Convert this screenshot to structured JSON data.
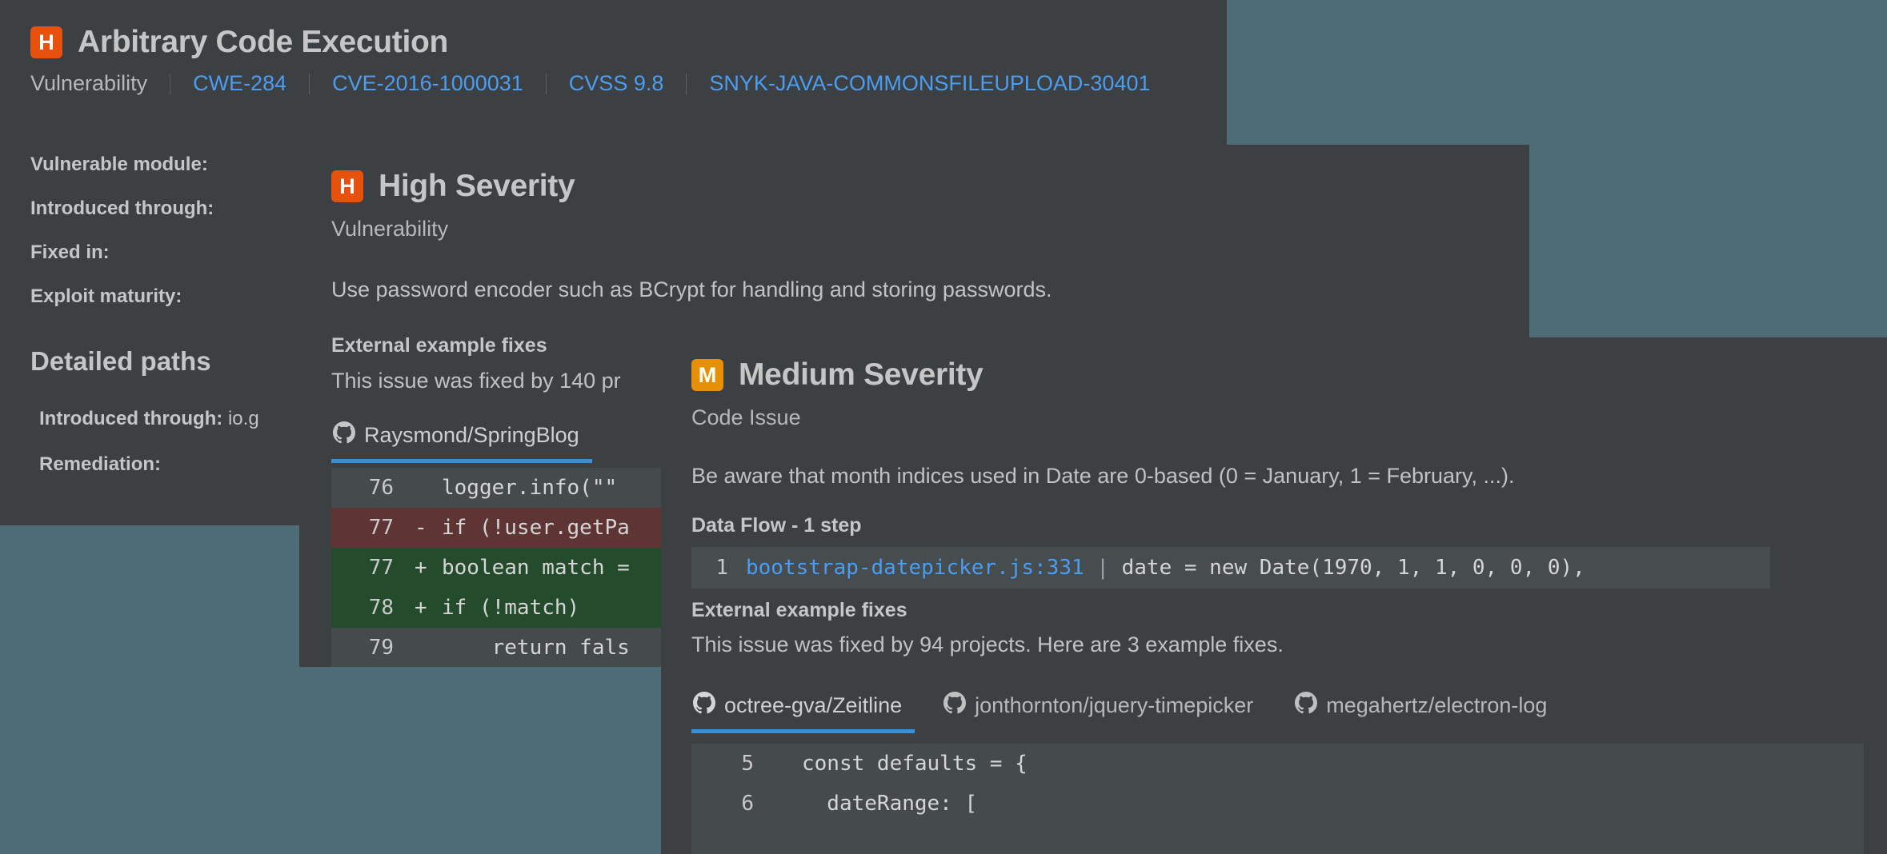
{
  "colors": {
    "desktop_background": "#4e6c76",
    "panel_background": "#3c4043",
    "high_severity": "#e6520e",
    "medium_severity": "#e69008",
    "link": "#4a9df0",
    "tab_active_underline": "#3b8fd4",
    "code_background": "#454a4d",
    "diff_removed": "#5e3434",
    "diff_added": "#234b2c"
  },
  "vulnerability_panel": {
    "badge_letter": "H",
    "badge_severity": "high",
    "title": "Arbitrary Code Execution",
    "meta": {
      "type": "Vulnerability",
      "links": [
        "CWE-284",
        "CVE-2016-1000031",
        "CVSS 9.8",
        "SNYK-JAVA-COMMONSFILEUPLOAD-30401"
      ]
    },
    "fields": [
      "Vulnerable module:",
      "Introduced through:",
      "Fixed in:",
      "Exploit maturity:"
    ],
    "detailed_paths_heading": "Detailed paths",
    "detailed_paths": [
      {
        "label": "Introduced through:",
        "value": "io.g"
      },
      {
        "label": "Remediation:",
        "value": ""
      }
    ]
  },
  "high_panel": {
    "badge_letter": "H",
    "badge_severity": "high",
    "title": "High Severity",
    "subtitle": "Vulnerability",
    "description": "Use password encoder such as BCrypt for handling and storing passwords.",
    "external_fixes_heading": "External example fixes",
    "external_fixes_summary": "This issue was fixed by 140 pr",
    "repo_tabs": [
      {
        "name": "Raysmond/SpringBlog",
        "active": true
      }
    ],
    "code_lines": [
      {
        "number": "76",
        "sign": "",
        "text": "logger.info(\"\" ",
        "kind": "context"
      },
      {
        "number": "77",
        "sign": "-",
        "text": "if (!user.getPa",
        "kind": "removed"
      },
      {
        "number": "77",
        "sign": "+",
        "text": "boolean match =",
        "kind": "added"
      },
      {
        "number": "78",
        "sign": "+",
        "text": "if (!match)",
        "kind": "added"
      },
      {
        "number": "79",
        "sign": "",
        "text": "    return fals",
        "kind": "context"
      }
    ]
  },
  "medium_panel": {
    "badge_letter": "M",
    "badge_severity": "medium",
    "title": "Medium Severity",
    "subtitle": "Code Issue",
    "description": "Be aware that month indices used in Date are 0-based (0 = January, 1 = February, ...).",
    "data_flow_heading": "Data Flow - 1 step",
    "data_flow": {
      "step_number": "1",
      "location": "bootstrap-datepicker.js:331",
      "separator": "|",
      "code": "date = new Date(1970, 1, 1, 0, 0, 0),"
    },
    "external_fixes_heading": "External example fixes",
    "external_fixes_summary": "This issue was fixed by 94 projects. Here are 3 example fixes.",
    "repo_tabs": [
      {
        "name": "octree-gva/Zeitline",
        "active": true
      },
      {
        "name": "jonthornton/jquery-timepicker",
        "active": false
      },
      {
        "name": "megahertz/electron-log",
        "active": false
      }
    ],
    "code_lines": [
      {
        "number": "5",
        "text": "const defaults = {"
      },
      {
        "number": "6",
        "text": "  dateRange: ["
      }
    ]
  }
}
